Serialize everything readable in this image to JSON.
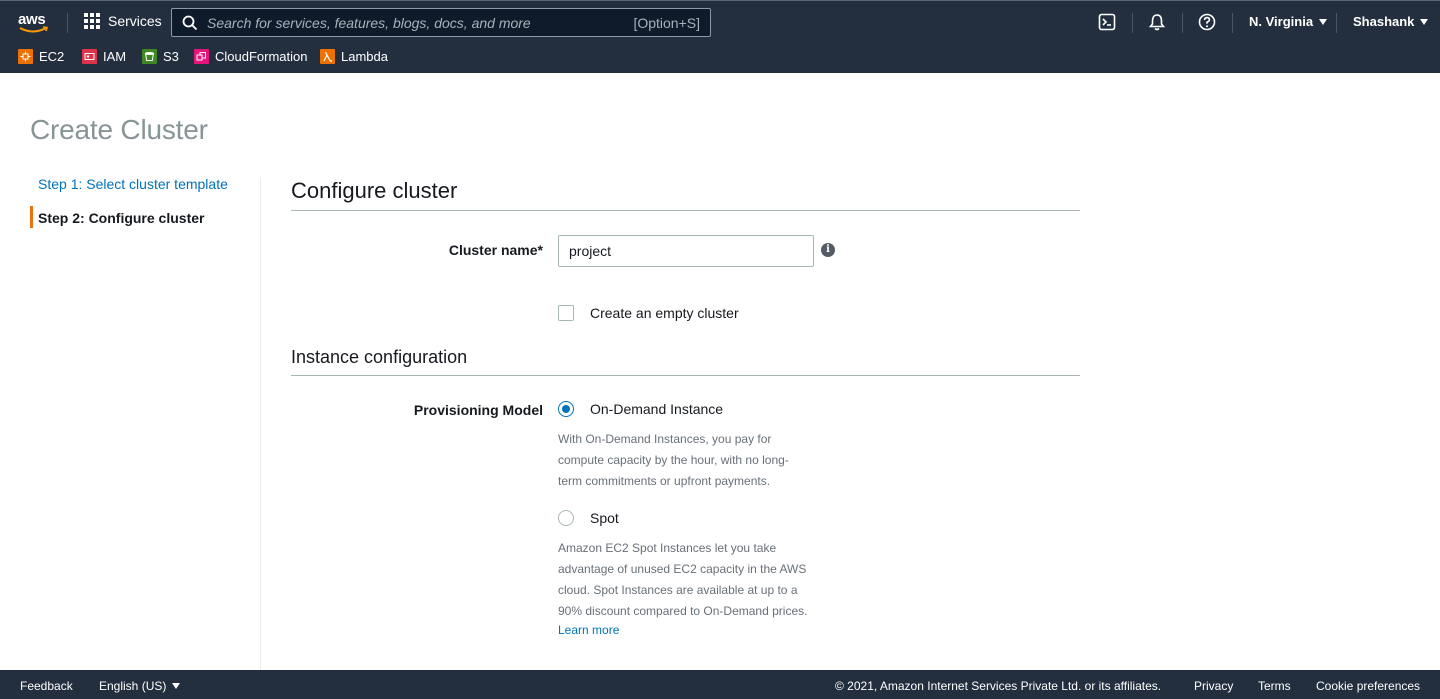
{
  "nav": {
    "logo_text": "aws",
    "services_label": "Services",
    "search": {
      "placeholder": "Search for services, features, blogs, docs, and more",
      "shortcut": "[Option+S]"
    },
    "region": "N. Virginia",
    "user": "Shashank",
    "favorites": [
      {
        "label": "EC2",
        "color": "#ed7100"
      },
      {
        "label": "IAM",
        "color": "#dd344c"
      },
      {
        "label": "S3",
        "color": "#3f8624"
      },
      {
        "label": "CloudFormation",
        "color": "#e7157b"
      },
      {
        "label": "Lambda",
        "color": "#ed7100"
      }
    ]
  },
  "page": {
    "title": "Create Cluster",
    "steps": [
      {
        "label": "Step 1: Select cluster template",
        "active": false
      },
      {
        "label": "Step 2: Configure cluster",
        "active": true
      }
    ]
  },
  "configure": {
    "heading": "Configure cluster",
    "cluster_name_label": "Cluster name*",
    "cluster_name_value": "project",
    "empty_cluster_label": "Create an empty cluster",
    "empty_cluster_checked": false
  },
  "instance": {
    "heading": "Instance configuration",
    "provisioning_label": "Provisioning Model",
    "options": [
      {
        "label": "On-Demand Instance",
        "selected": true,
        "description": [
          "With On-Demand Instances, you pay for",
          "compute capacity by the hour, with no long-",
          "term commitments or upfront payments."
        ]
      },
      {
        "label": "Spot",
        "selected": false,
        "description": [
          "Amazon EC2 Spot Instances let you take",
          "advantage of unused EC2 capacity in the AWS",
          "cloud. Spot Instances are available at up to a",
          "90% discount compared to On-Demand prices."
        ]
      }
    ],
    "learn_more": "Learn more"
  },
  "footer": {
    "feedback": "Feedback",
    "language": "English (US)",
    "copyright": "© 2021, Amazon Internet Services Private Ltd. or its affiliates.",
    "privacy": "Privacy",
    "terms": "Terms",
    "cookies": "Cookie preferences"
  },
  "colors": {
    "nav_bg": "#232f3e",
    "link": "#0073bb",
    "active_step": "#ec7211"
  }
}
